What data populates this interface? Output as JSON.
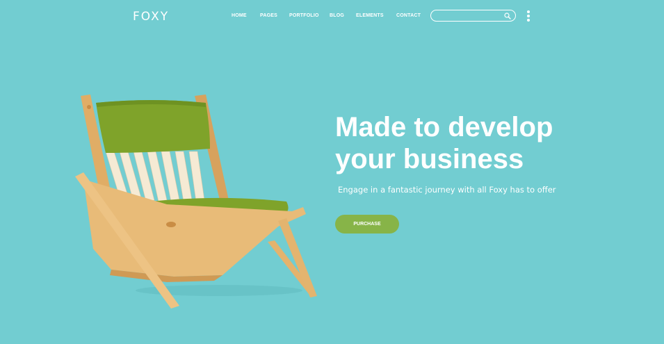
{
  "header": {
    "logo_text": "FOXY",
    "nav": [
      {
        "label": "HOME"
      },
      {
        "label": "PAGES"
      },
      {
        "label": "PORTFOLIO"
      },
      {
        "label": "BLOG"
      },
      {
        "label": "ELEMENTS"
      },
      {
        "label": "CONTACT"
      }
    ],
    "search": {
      "placeholder": "",
      "value": ""
    },
    "icons": {
      "search": "search-icon",
      "menu": "vertical-dots-menu-icon"
    }
  },
  "hero": {
    "title_line1": "Made to develop",
    "title_line2": "your business",
    "subtitle": "Engage in a fantastic journey with all Foxy has to offer",
    "cta_label": "PURCHASE",
    "image": "wooden-lounge-chair-green-cushion"
  },
  "colors": {
    "background": "#72cdd1",
    "accent": "#87b448",
    "text": "#ffffff",
    "wood": "#e8bb78",
    "cushion": "#7fa32a"
  }
}
